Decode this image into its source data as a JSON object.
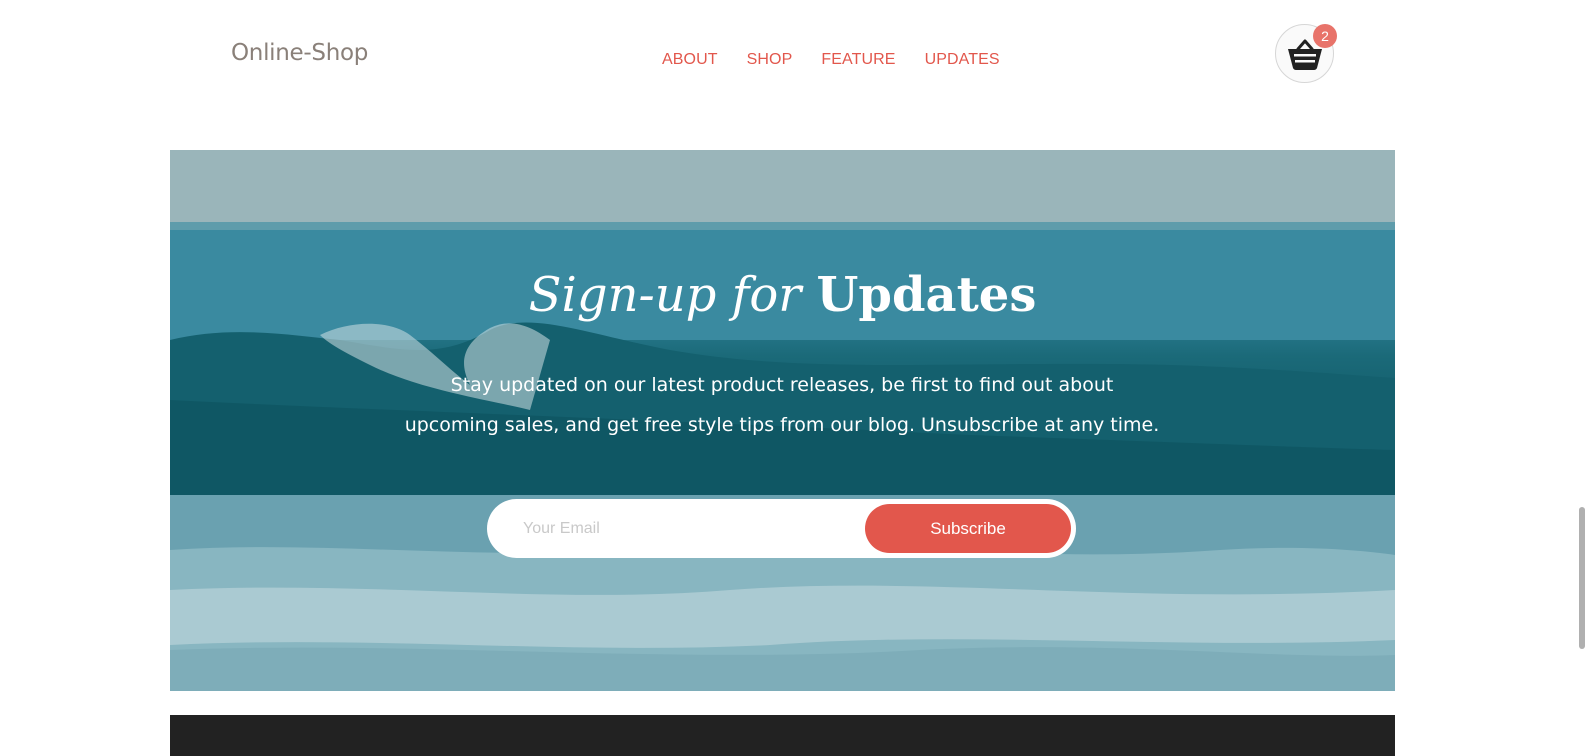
{
  "header": {
    "logo": "Online-Shop",
    "nav": [
      "ABOUT",
      "SHOP",
      "FEATURE",
      "UPDATES"
    ],
    "cart": {
      "icon": "basket-icon",
      "count": "2",
      "badge_color": "#e8736a"
    }
  },
  "hero": {
    "title_italic": "Sign-up for",
    "title_bold": "Updates",
    "text_line1": "Stay updated on our latest product releases, be first to find out about",
    "text_line2": "upcoming sales, and get free style tips from our blog. Unsubscribe at any time.",
    "email_placeholder": "Your Email",
    "subscribe_label": "Subscribe"
  },
  "colors": {
    "accent": "#e2574c",
    "logo": "#8a8079",
    "footer": "#222222"
  }
}
